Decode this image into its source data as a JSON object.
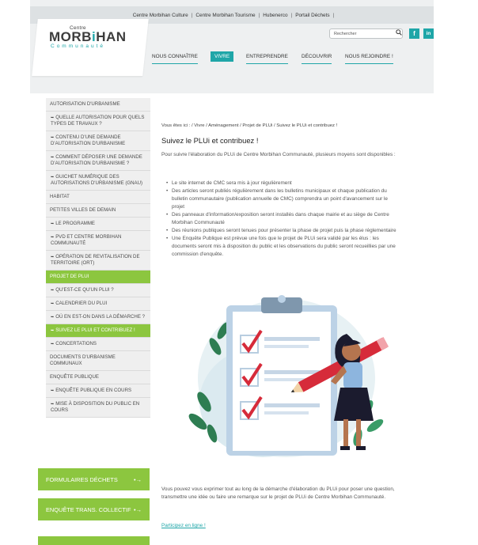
{
  "topbar": {
    "links": [
      "Centre Morbihan Culture",
      "Centre Morbihan Tourisme",
      "Hubenerco",
      "Portail Déchets"
    ]
  },
  "logo": {
    "line1": "Centre",
    "line2a": "MORB",
    "line2b": "i",
    "line2c": "HAN",
    "line3": "Communauté"
  },
  "search": {
    "placeholder": "Rechercher"
  },
  "social": {
    "facebook": "f",
    "linkedin": "in"
  },
  "nav": {
    "items": [
      "NOUS CONNAÎTRE",
      "VIVRE",
      "ENTREPRENDRE",
      "DÉCOUVRIR",
      "NOUS REJOINDRE !"
    ],
    "active": "VIVRE"
  },
  "sidebar": {
    "items": [
      {
        "label": "AUTORISATION D'URBANISME",
        "sub": false
      },
      {
        "label": "QUELLE AUTORISATION POUR QUELS TYPES DE TRAVAUX ?",
        "sub": true
      },
      {
        "label": "CONTENU D'UNE DEMANDE D'AUTORISATION D'URBANISME",
        "sub": true
      },
      {
        "label": "COMMENT DÉPOSER UNE DEMANDE D'AUTORISATION D'URBANISME ?",
        "sub": true
      },
      {
        "label": "GUICHET NUMÉRIQUE DES AUTORISATIONS D'URBANISME (GNAU)",
        "sub": true
      },
      {
        "label": "HABITAT",
        "sub": false
      },
      {
        "label": "PETITES VILLES DE DEMAIN",
        "sub": false
      },
      {
        "label": "LE PROGRAMME",
        "sub": true
      },
      {
        "label": "PVD ET CENTRE MORBIHAN COMMUNAUTÉ",
        "sub": true
      },
      {
        "label": "OPÉRATION DE REVITALISATION DE TERRITOIRE (ORT)",
        "sub": true
      },
      {
        "label": "PROJET DE PLUI",
        "sub": false,
        "active": true
      },
      {
        "label": "QU'EST-CE QU'UN PLUI ?",
        "sub": true
      },
      {
        "label": "CALENDRIER DU PLUI",
        "sub": true
      },
      {
        "label": "OÙ EN EST-ON DANS LA DÉMARCHE ?",
        "sub": true
      },
      {
        "label": "SUIVEZ LE PLUI ET CONTRIBUEZ !",
        "sub": true,
        "active": true
      },
      {
        "label": "CONCERTATIONS",
        "sub": true
      },
      {
        "label": "DOCUMENTS D'URBANISME COMMUNAUX",
        "sub": false
      },
      {
        "label": "ENQUÊTE PUBLIQUE",
        "sub": false
      },
      {
        "label": "ENQUÊTE PUBLIQUE EN COURS",
        "sub": true
      },
      {
        "label": "MISE À DISPOSITION DU PUBLIC EN COURS",
        "sub": true
      }
    ],
    "blocks": [
      {
        "label": "FORMULAIRES DÉCHETS",
        "arrow": "•→"
      },
      {
        "label": "ENQUÊTE TRANS. COLLECTIF",
        "arrow": "•→"
      }
    ]
  },
  "breadcrumb": "Vous êtes ici : / Vivre / Aménagement / Projet de PLUi / Suivez le PLUi et contribuez !",
  "main": {
    "title": "Suivez le PLUi et contribuez !",
    "intro": "Pour suivre l'élaboration du PLUi de Centre Morbihan Communauté, plusieurs moyens sont disponibles :",
    "bullets": [
      "Le site internet de CMC sera mis à jour régulièrement",
      "Des articles seront publiés régulièrement dans les bulletins municipaux et chaque publication du bulletin communautaire (publication annuelle de CMC) comprendra un point d'avancement sur le projet",
      "Des panneaux d'information/exposition seront installés dans chaque mairie et au siège de Centre Morbihan Communauté",
      "Des réunions publiques seront tenues pour présenter la phase de projet puis la phase réglementaire",
      "Une Enquête Publique est prévue une fois que le projet de PLUi sera validé par les élus : les documents seront mis à disposition du public et les observations du public seront recueillies par une commission d'enquête."
    ],
    "outro": "Vous pouvez vous exprimer tout au long de la démarche d'élaboration du PLUi pour poser une question, transmettre une idée ou faire une remarque sur le projet de PLUi de Centre Morbihan Communauté.",
    "link": "Participez en ligne !"
  },
  "colors": {
    "accent": "#1fa6a8",
    "green": "#8cc63f",
    "check": "#d62b3a"
  }
}
